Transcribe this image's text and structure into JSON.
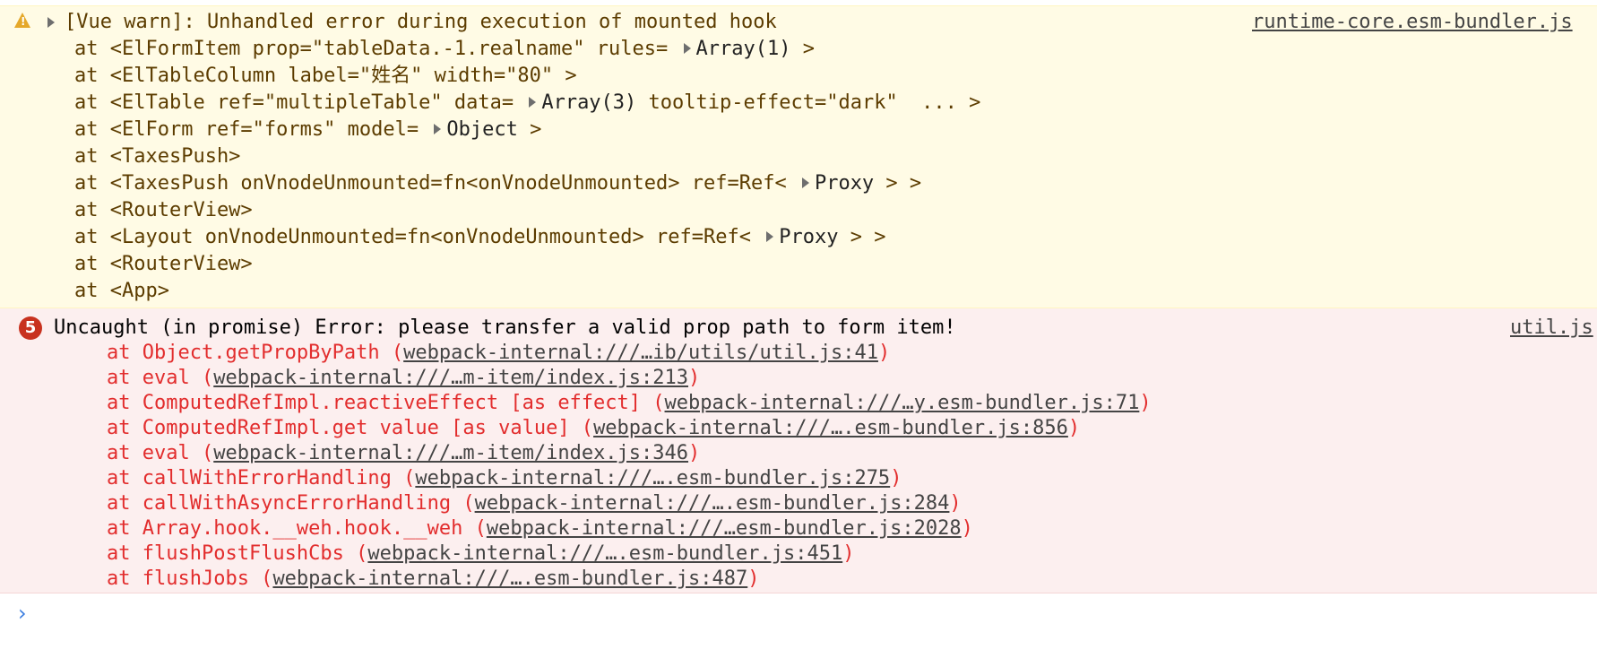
{
  "warning": {
    "icon": "warning-triangle-icon",
    "message": "[Vue warn]: Unhandled error during execution of mounted hook",
    "source": "runtime-core.esm-bundler.js",
    "trace": [
      {
        "pre": "at <ElFormItem prop=\"tableData.-1.realname\" rules= ",
        "obj": "Array(1)",
        "post": " >"
      },
      {
        "pre": "at <ElTableColumn label=\"姓名\" width=\"80\" >",
        "obj": null,
        "post": ""
      },
      {
        "pre": "at <ElTable ref=\"multipleTable\" data= ",
        "obj": "Array(3)",
        "post": " tooltip-effect=\"dark\"  ... >"
      },
      {
        "pre": "at <ElForm ref=\"forms\" model= ",
        "obj": "Object",
        "post": " >"
      },
      {
        "pre": "at <TaxesPush>",
        "obj": null,
        "post": ""
      },
      {
        "pre": "at <TaxesPush onVnodeUnmounted=fn<onVnodeUnmounted> ref=Ref< ",
        "obj": "Proxy",
        "post": " > >"
      },
      {
        "pre": "at <RouterView>",
        "obj": null,
        "post": ""
      },
      {
        "pre": "at <Layout onVnodeUnmounted=fn<onVnodeUnmounted> ref=Ref< ",
        "obj": "Proxy",
        "post": " > >"
      },
      {
        "pre": "at <RouterView>",
        "obj": null,
        "post": ""
      },
      {
        "pre": "at <App>",
        "obj": null,
        "post": ""
      }
    ]
  },
  "error": {
    "count": "5",
    "message": "Uncaught (in promise) Error: please transfer a valid prop path to form item!",
    "source": "util.js",
    "trace": [
      {
        "fn": "at Object.getPropByPath (",
        "link": "webpack-internal:///…ib/utils/util.js:41",
        "end": ")"
      },
      {
        "fn": "at eval (",
        "link": "webpack-internal:///…m-item/index.js:213",
        "end": ")"
      },
      {
        "fn": "at ComputedRefImpl.reactiveEffect [as effect] (",
        "link": "webpack-internal:///…y.esm-bundler.js:71",
        "end": ")"
      },
      {
        "fn": "at ComputedRefImpl.get value [as value] (",
        "link": "webpack-internal:///….esm-bundler.js:856",
        "end": ")"
      },
      {
        "fn": "at eval (",
        "link": "webpack-internal:///…m-item/index.js:346",
        "end": ")"
      },
      {
        "fn": "at callWithErrorHandling (",
        "link": "webpack-internal:///….esm-bundler.js:275",
        "end": ")"
      },
      {
        "fn": "at callWithAsyncErrorHandling (",
        "link": "webpack-internal:///….esm-bundler.js:284",
        "end": ")"
      },
      {
        "fn": "at Array.hook.__weh.hook.__weh (",
        "link": "webpack-internal:///…esm-bundler.js:2028",
        "end": ")"
      },
      {
        "fn": "at flushPostFlushCbs (",
        "link": "webpack-internal:///….esm-bundler.js:451",
        "end": ")"
      },
      {
        "fn": "at flushJobs (",
        "link": "webpack-internal:///….esm-bundler.js:487",
        "end": ")"
      }
    ]
  },
  "console": {
    "prompt": "›",
    "prompt_icon": "chevron-right-icon"
  },
  "colors": {
    "warning_bg": "#fffbe5",
    "warning_text": "#5c3c00",
    "error_bg": "#fcefef",
    "error_text": "#e22d2d",
    "badge": "#c8321f"
  }
}
